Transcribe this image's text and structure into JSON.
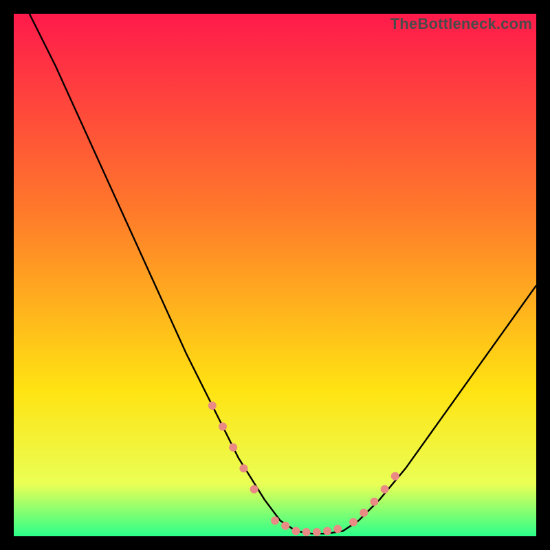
{
  "watermark": "TheBottleneck.com",
  "chart_data": {
    "type": "line",
    "title": "",
    "xlabel": "",
    "ylabel": "",
    "xlim": [
      0,
      100
    ],
    "ylim": [
      0,
      100
    ],
    "grid": false,
    "legend": false,
    "background_gradient": {
      "top_color": "#ff1a4b",
      "mid_color_1": "#ff7a2a",
      "mid_color_2": "#ffe312",
      "bottom_color": "#2bff8a"
    },
    "series": [
      {
        "name": "curve",
        "stroke": "#000000",
        "x": [
          3,
          8,
          13,
          18,
          23,
          28,
          33,
          38,
          43,
          48,
          51,
          54,
          57,
          60,
          63,
          66,
          70,
          75,
          80,
          85,
          90,
          95,
          100
        ],
        "y": [
          100,
          90,
          79,
          68,
          57,
          46,
          35,
          25,
          15,
          7,
          3,
          1,
          0.5,
          0.5,
          1,
          3,
          7,
          13,
          20,
          27,
          34,
          41,
          48
        ]
      }
    ],
    "markers": {
      "name": "dots",
      "color": "#e98a84",
      "radius_px": 6,
      "x": [
        38,
        40,
        42,
        44,
        46,
        50,
        52,
        54,
        56,
        58,
        60,
        62,
        65,
        67,
        69,
        71,
        73
      ],
      "y": [
        25,
        21,
        17,
        13,
        9,
        3,
        2,
        1,
        0.8,
        0.8,
        1,
        1.4,
        2.7,
        4.5,
        6.6,
        9,
        11.5
      ]
    }
  }
}
